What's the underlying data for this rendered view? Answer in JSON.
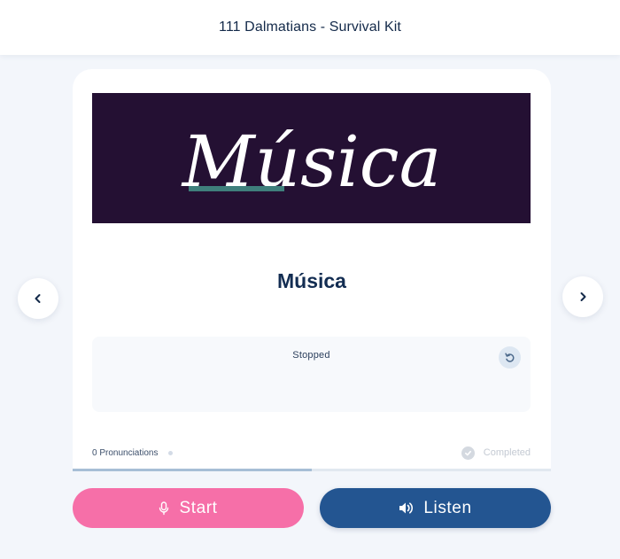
{
  "header": {
    "title": "111 Dalmatians - Survival Kit"
  },
  "card": {
    "banner_text": "Música",
    "word": "Música",
    "recorder": {
      "status": "Stopped"
    },
    "pronunciations_label": "0 Pronunciations",
    "completed_label": "Completed",
    "progress": 0.5
  },
  "actions": {
    "start_label": "Start",
    "listen_label": "Listen"
  },
  "icons": {
    "prev": "chevron-left-icon",
    "next": "chevron-right-icon",
    "reset": "reset-icon",
    "check": "check-circle-icon",
    "mic": "microphone-icon",
    "speaker": "speaker-icon"
  },
  "colors": {
    "start": "#f66fa8",
    "listen": "#235591",
    "banner_bg": "#241033",
    "banner_underline": "#3f7f7c",
    "word": "#132d52"
  }
}
